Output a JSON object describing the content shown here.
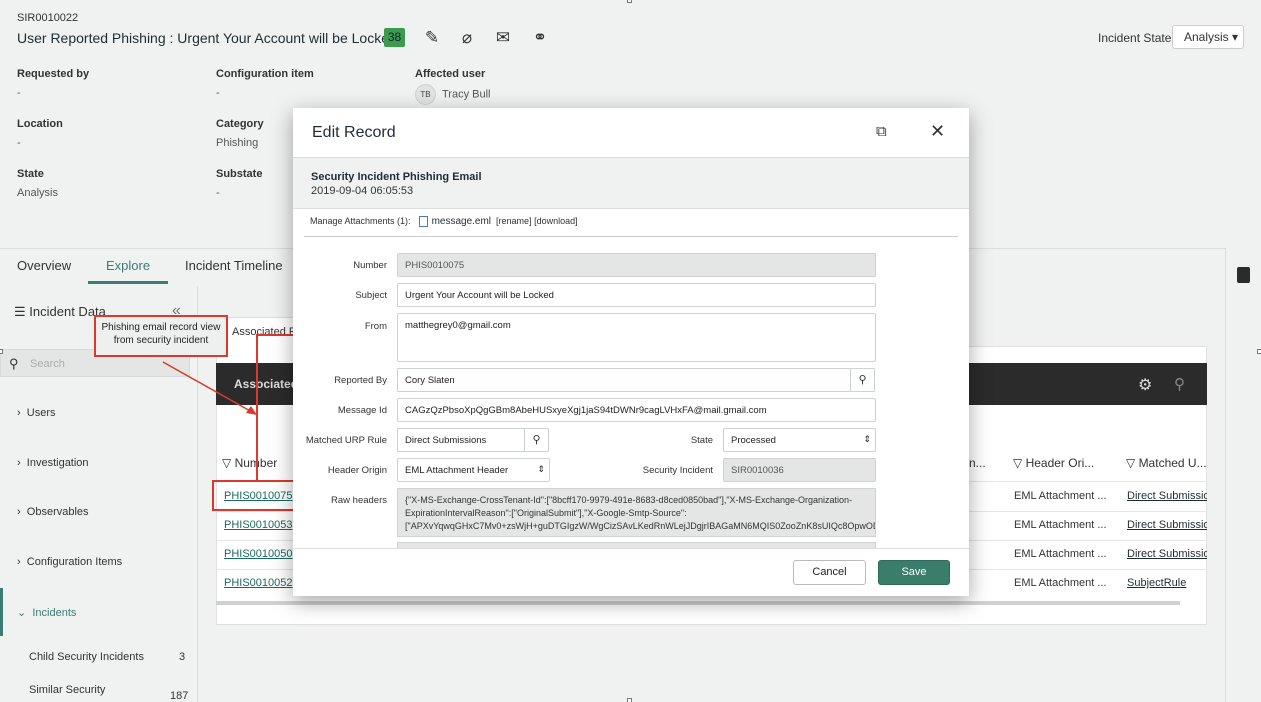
{
  "record": {
    "number": "SIR0010022",
    "title": "User Reported Phishing : Urgent Your Account will be Locked",
    "badge": "38",
    "incident_state_label": "Incident State:",
    "incident_state_value": "Analysis ▾"
  },
  "fields": {
    "requested_by": {
      "label": "Requested by",
      "value": "-"
    },
    "configuration_item": {
      "label": "Configuration item",
      "value": "-"
    },
    "affected_user": {
      "label": "Affected user",
      "initials": "TB",
      "value": "Tracy Bull"
    },
    "location": {
      "label": "Location",
      "value": "-"
    },
    "category": {
      "label": "Category",
      "value": "Phishing"
    },
    "state": {
      "label": "State",
      "value": "Analysis"
    },
    "substate": {
      "label": "Substate",
      "value": "-"
    }
  },
  "tabs": [
    "Overview",
    "Explore",
    "Incident Timeline"
  ],
  "sidebar": {
    "title": "Incident Data",
    "search_placeholder": "Search",
    "items": [
      "Users",
      "Investigation",
      "Observables",
      "Configuration Items",
      "Incidents"
    ],
    "sub_items": [
      {
        "label": "Child Security Incidents",
        "count": "3"
      },
      {
        "label": "Similar Security",
        "count": "187"
      }
    ]
  },
  "related": {
    "sub_tab": "Associated P",
    "bar_title": "Associated I",
    "columns": [
      "Number",
      "n...",
      "Header Ori...",
      "Matched U..."
    ],
    "rows": [
      {
        "number": "PHIS0010075",
        "header": "EML Attachment ...",
        "matched": "Direct Submissio"
      },
      {
        "number": "PHIS0010053",
        "header": "EML Attachment ...",
        "matched": "Direct Submissio"
      },
      {
        "number": "PHIS0010050",
        "header": "EML Attachment ...",
        "matched": "Direct Submissio"
      },
      {
        "number": "PHIS0010052",
        "header": "EML Attachment ...",
        "matched": "SubjectRule"
      }
    ]
  },
  "annotation": {
    "callout": "Phishing email record view from security incident"
  },
  "modal": {
    "title": "Edit Record",
    "subtitle": "Security Incident Phishing Email",
    "timestamp": "2019-09-04 06:05:53",
    "attachments_label": "Manage Attachments (1):",
    "attachment_file": "message.eml",
    "attachment_actions": "[rename] [download]",
    "form": {
      "number": {
        "label": "Number",
        "value": "PHIS0010075"
      },
      "subject": {
        "label": "Subject",
        "value": "Urgent Your Account will be Locked"
      },
      "from": {
        "label": "From",
        "value": "matthegrey0@gmail.com"
      },
      "reported_by": {
        "label": "Reported By",
        "value": "Cory Slaten"
      },
      "message_id": {
        "label": "Message Id",
        "value": "CAGzQzPbsoXpQgGBm8AbeHUSxyeXgj1jaS94tDWNr9cagLVHxFA@mail.gmail.com"
      },
      "matched_urp_rule": {
        "label": "Matched URP Rule",
        "value": "Direct Submissions"
      },
      "state": {
        "label": "State",
        "value": "Processed"
      },
      "header_origin": {
        "label": "Header Origin",
        "value": "EML Attachment Header"
      },
      "security_incident": {
        "label": "Security Incident",
        "value": "SIR0010036"
      },
      "raw_headers": {
        "label": "Raw headers",
        "value": "{\"X-MS-Exchange-CrossTenant-Id\":[\"8bcff170-9979-491e-8683-d8ced0850bad\"],\"X-MS-Exchange-Organization-\nExpirationIntervalReason\":[\"OriginalSubmit\"],\"X-Google-Smtp-Source\":\n[\"APXvYqwqGHxC7Mv0+zsWjH+guDTGIgzW/WgCizSAvLKedRnWLejJDgjrIBAGaMN6MQIS0ZooZnK8sUIQc8OpwOD/J"
      }
    },
    "cancel_label": "Cancel",
    "save_label": "Save"
  }
}
